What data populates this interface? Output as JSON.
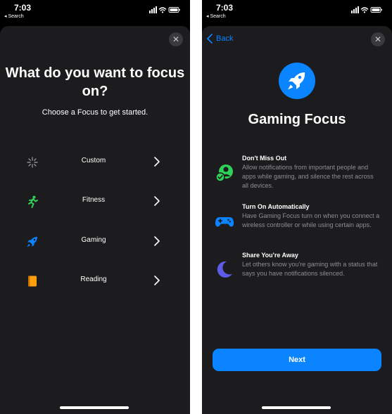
{
  "left": {
    "status": {
      "time": "7:03",
      "back_app": "◂ Search"
    },
    "close_glyph": "✕",
    "title": "What do you want to focus on?",
    "subtitle": "Choose a Focus to get started.",
    "options": [
      {
        "label": "Custom",
        "icon": "sparkle-icon",
        "color": "#8e8e93"
      },
      {
        "label": "Fitness",
        "icon": "running-figure-icon",
        "color": "#30d158"
      },
      {
        "label": "Gaming",
        "icon": "rocket-icon",
        "color": "#0a84ff"
      },
      {
        "label": "Reading",
        "icon": "book-icon",
        "color": "#ff9f0a"
      }
    ]
  },
  "right": {
    "status": {
      "time": "7:03",
      "back_app": "◂ Search"
    },
    "back_label": "Back",
    "close_glyph": "✕",
    "title": "Gaming Focus",
    "features": [
      {
        "title": "Don't Miss Out",
        "text": "Allow notifications from important people and apps while gaming, and silence the rest across all devices.",
        "icon": "person-check-icon",
        "color": "#30d158"
      },
      {
        "title": "Turn On Automatically",
        "text": "Have Gaming Focus turn on when you connect a wireless controller or while using certain apps.",
        "icon": "game-controller-icon",
        "color": "#0a84ff"
      },
      {
        "title": "Share You're Away",
        "text": "Let others know you're gaming with a status that says you have notifications silenced.",
        "icon": "moon-icon",
        "color": "#5e5ce6"
      }
    ],
    "next_label": "Next"
  },
  "colors": {
    "accent": "#0a84ff",
    "sheet": "#1c1c1e",
    "secondary_text": "#8e8e93"
  }
}
